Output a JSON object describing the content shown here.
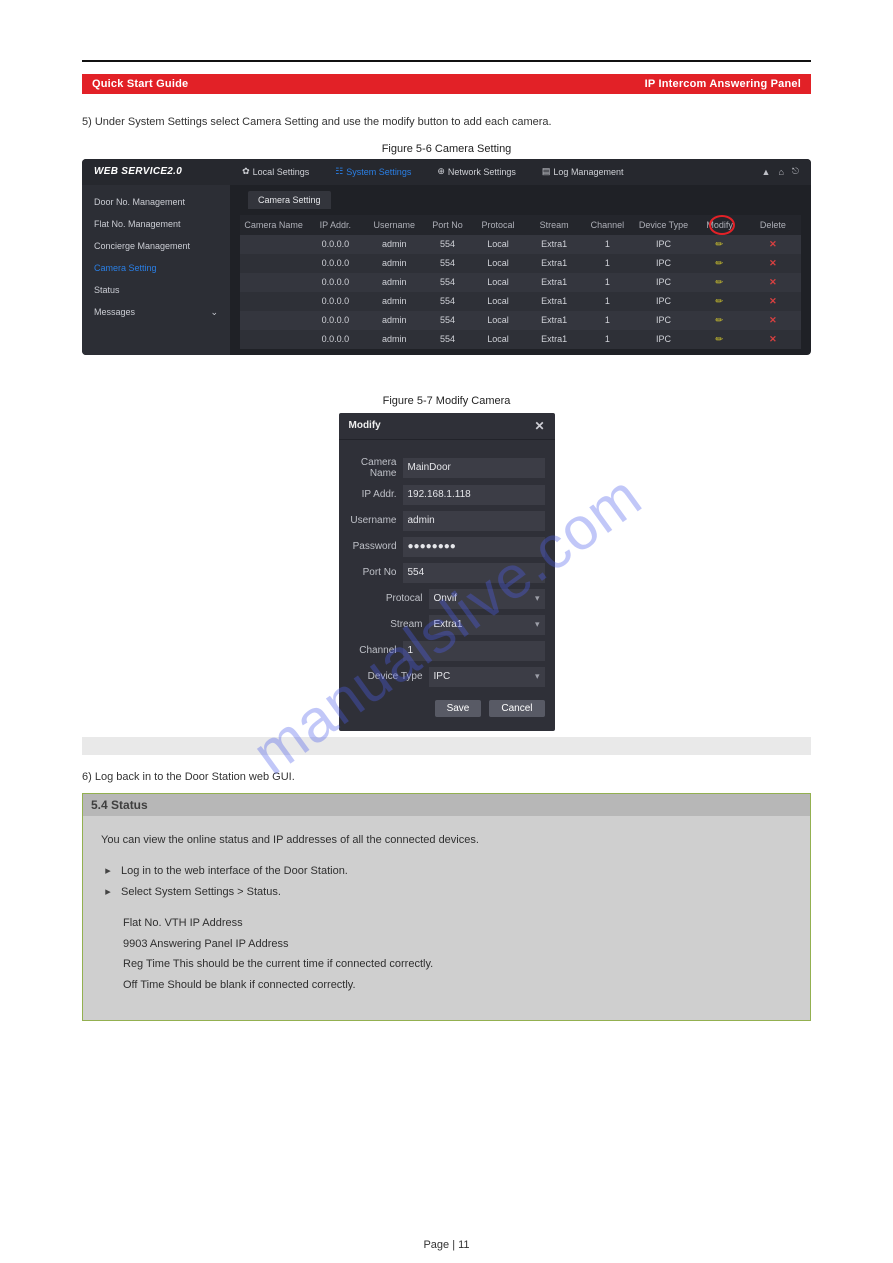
{
  "page_title": "Quick Start Guide",
  "redbar": {
    "left": "Quick Start Guide",
    "right": "IP Intercom Answering Panel"
  },
  "intro_step": "5) Under System Settings select Camera Setting and use the modify button to add each camera.",
  "fig1_cap": "Figure 5-6 Camera Setting",
  "fig2_cap": "Figure 5-7 Modify Camera",
  "back_text": "6) Log back in to the Door Station web GUI.",
  "app1": {
    "brand": "WEB SERVICE2.0",
    "nav": [
      "Local Settings",
      "System Settings",
      "Network Settings",
      "Log Management"
    ],
    "sidebar": [
      "Door No. Management",
      "Flat No. Management",
      "Concierge Management",
      "Camera Setting",
      "Status",
      "Messages"
    ],
    "tab": "Camera Setting",
    "cols": [
      "Camera Name",
      "IP Addr.",
      "Username",
      "Port No",
      "Protocal",
      "Stream",
      "Channel",
      "Device Type",
      "Modify",
      "Delete"
    ],
    "rows": [
      {
        "ip": "0.0.0.0",
        "user": "admin",
        "port": "554",
        "prot": "Local",
        "stream": "Extra1",
        "chan": "1",
        "type": "IPC"
      },
      {
        "ip": "0.0.0.0",
        "user": "admin",
        "port": "554",
        "prot": "Local",
        "stream": "Extra1",
        "chan": "1",
        "type": "IPC"
      },
      {
        "ip": "0.0.0.0",
        "user": "admin",
        "port": "554",
        "prot": "Local",
        "stream": "Extra1",
        "chan": "1",
        "type": "IPC"
      },
      {
        "ip": "0.0.0.0",
        "user": "admin",
        "port": "554",
        "prot": "Local",
        "stream": "Extra1",
        "chan": "1",
        "type": "IPC"
      },
      {
        "ip": "0.0.0.0",
        "user": "admin",
        "port": "554",
        "prot": "Local",
        "stream": "Extra1",
        "chan": "1",
        "type": "IPC"
      },
      {
        "ip": "0.0.0.0",
        "user": "admin",
        "port": "554",
        "prot": "Local",
        "stream": "Extra1",
        "chan": "1",
        "type": "IPC"
      }
    ]
  },
  "modal": {
    "title": "Modify",
    "camera_name_label": "Camera Name",
    "camera_name": "MainDoor",
    "ip_label": "IP Addr.",
    "ip": "192.168.1.118",
    "user_label": "Username",
    "user": "admin",
    "pass_label": "Password",
    "pass": "●●●●●●●●",
    "port_label": "Port No",
    "port": "554",
    "prot_label": "Protocal",
    "prot": "Onvif",
    "stream_label": "Stream",
    "stream": "Extra1",
    "chan_label": "Channel",
    "chan": "1",
    "type_label": "Device Type",
    "type": "IPC",
    "save": "Save",
    "cancel": "Cancel"
  },
  "status": {
    "heading": "5.4 Status",
    "intro": "You can view the online status and IP addresses of all the connected devices.",
    "step1": "Log in to the web interface of the Door Station.",
    "step2": "Select System Settings > Status.",
    "line_flat": "Flat No.  VTH IP Address",
    "line_ans": "9903 Answering Panel IP Address",
    "line_reg": "Reg Time This should be the current time if connected correctly.",
    "line_off": "Off Time Should be blank if connected correctly."
  },
  "pagefoot": "Page | 11"
}
